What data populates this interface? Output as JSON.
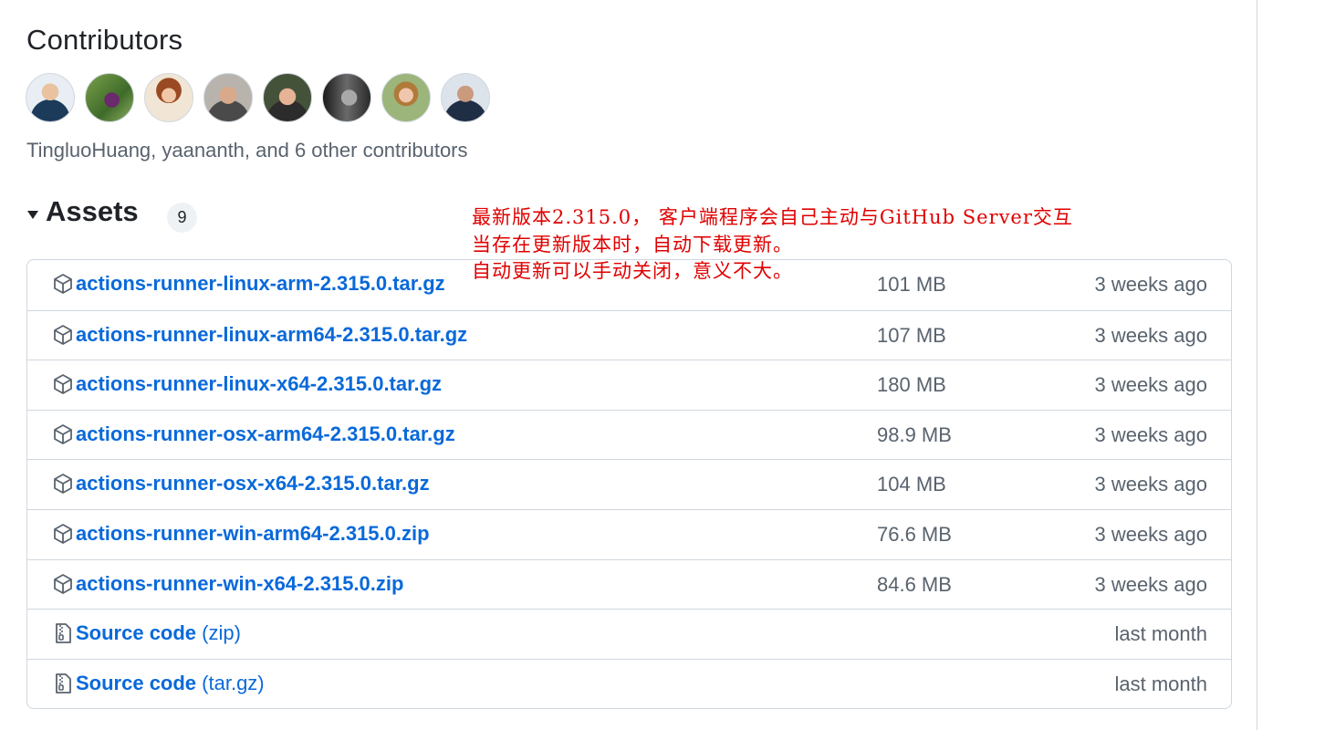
{
  "contributors": {
    "title": "Contributors",
    "summary": "TingluoHuang, yaananth, and 6 other contributors",
    "avatars": [
      {
        "name": "contributor-avatar-1"
      },
      {
        "name": "contributor-avatar-2"
      },
      {
        "name": "contributor-avatar-3"
      },
      {
        "name": "contributor-avatar-4"
      },
      {
        "name": "contributor-avatar-5"
      },
      {
        "name": "contributor-avatar-6"
      },
      {
        "name": "contributor-avatar-7"
      },
      {
        "name": "contributor-avatar-8"
      }
    ]
  },
  "assets": {
    "title": "Assets",
    "count": "9",
    "icon": "triangle-down-icon",
    "items": [
      {
        "name": "actions-runner-linux-arm-2.315.0.tar.gz",
        "size": "101 MB",
        "date": "3 weeks ago",
        "icon": "package-icon"
      },
      {
        "name": "actions-runner-linux-arm64-2.315.0.tar.gz",
        "size": "107 MB",
        "date": "3 weeks ago",
        "icon": "package-icon"
      },
      {
        "name": "actions-runner-linux-x64-2.315.0.tar.gz",
        "size": "180 MB",
        "date": "3 weeks ago",
        "icon": "package-icon"
      },
      {
        "name": "actions-runner-osx-arm64-2.315.0.tar.gz",
        "size": "98.9 MB",
        "date": "3 weeks ago",
        "icon": "package-icon"
      },
      {
        "name": "actions-runner-osx-x64-2.315.0.tar.gz",
        "size": "104 MB",
        "date": "3 weeks ago",
        "icon": "package-icon"
      },
      {
        "name": "actions-runner-win-arm64-2.315.0.zip",
        "size": "76.6 MB",
        "date": "3 weeks ago",
        "icon": "package-icon"
      },
      {
        "name": "actions-runner-win-x64-2.315.0.zip",
        "size": "84.6 MB",
        "date": "3 weeks ago",
        "icon": "package-icon"
      }
    ],
    "source": [
      {
        "name": "Source code",
        "suffix": "(zip)",
        "date": "last month",
        "icon": "file-zip-icon"
      },
      {
        "name": "Source code",
        "suffix": "(tar.gz)",
        "date": "last month",
        "icon": "file-zip-icon"
      }
    ]
  },
  "annotation": {
    "lines": [
      "最新版本2.315.0， 客户端程序会自己主动与GitHub Server交互",
      "当存在更新版本时，自动下载更新。",
      "自动更新可以手动关闭，意义不大。"
    ],
    "color": "#e00000"
  },
  "colors": {
    "link": "#0969da",
    "muted": "#59636e",
    "border": "#d0d7de"
  }
}
